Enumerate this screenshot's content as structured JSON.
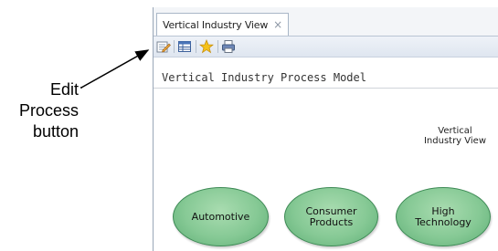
{
  "tab": {
    "title": "Vertical Industry View",
    "close": "×"
  },
  "toolbar": {
    "buttons": [
      {
        "name": "edit-process-icon"
      },
      {
        "name": "table-view-icon"
      },
      {
        "name": "favorite-star-icon"
      },
      {
        "name": "print-icon"
      }
    ]
  },
  "view": {
    "title": "Vertical Industry Process Model",
    "label": "Vertical\nIndustry View"
  },
  "nodes": [
    {
      "label": "Automotive"
    },
    {
      "label": "Consumer\nProducts"
    },
    {
      "label": "High\nTechnology"
    }
  ],
  "callout": {
    "text": "Edit\nProcess\nbutton"
  },
  "colors": {
    "node_fill": "#86c995",
    "node_border": "#3d8a55",
    "toolbar": "#dfe6f0"
  }
}
